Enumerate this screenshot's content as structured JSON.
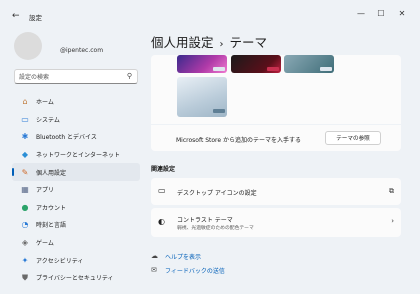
{
  "window": {
    "title": "設定",
    "back_glyph": "←",
    "minimize_glyph": "—",
    "maximize_glyph": "☐",
    "close_glyph": "✕"
  },
  "profile": {
    "email": "@ipentec.com"
  },
  "search": {
    "placeholder": "設定の検索"
  },
  "nav": {
    "items": [
      {
        "label": "ホーム",
        "icon": "home-icon",
        "glyph": "⌂",
        "color": "#c07a3a"
      },
      {
        "label": "システム",
        "icon": "system-icon",
        "glyph": "▭",
        "color": "#2b7bd6"
      },
      {
        "label": "Bluetooth とデバイス",
        "icon": "bluetooth-icon",
        "glyph": "✱",
        "color": "#2b7bd6"
      },
      {
        "label": "ネットワークとインターネット",
        "icon": "network-icon",
        "glyph": "◆",
        "color": "#2b8fd6"
      },
      {
        "label": "個人用設定",
        "icon": "personalization-icon",
        "glyph": "✎",
        "color": "#d06a2a"
      },
      {
        "label": "アプリ",
        "icon": "apps-icon",
        "glyph": "▦",
        "color": "#5a6a8a"
      },
      {
        "label": "アカウント",
        "icon": "accounts-icon",
        "glyph": "●",
        "color": "#2ba36a"
      },
      {
        "label": "時刻と言語",
        "icon": "time-language-icon",
        "glyph": "◔",
        "color": "#2b7bd6"
      },
      {
        "label": "ゲーム",
        "icon": "gaming-icon",
        "glyph": "◈",
        "color": "#6a6a6a"
      },
      {
        "label": "アクセシビリティ",
        "icon": "accessibility-icon",
        "glyph": "✦",
        "color": "#2b7bd6"
      },
      {
        "label": "プライバシーとセキュリティ",
        "icon": "privacy-icon",
        "glyph": "⛊",
        "color": "#6a6a6a"
      }
    ],
    "active_index": 4
  },
  "header": {
    "crumb": "個人用設定",
    "separator": "›",
    "page": "テーマ"
  },
  "themes": {
    "store_text": "Microsoft Store から追加のテーマを入手する",
    "browse_button": "テーマの参照"
  },
  "related": {
    "heading": "関連設定",
    "desktop_icons": {
      "title": "デスクトップ アイコンの設定",
      "end_glyph": "⧉"
    },
    "contrast": {
      "title": "コントラスト テーマ",
      "subtitle": "弱視、光過敏症のための配色テーマ",
      "end_glyph": "›"
    }
  },
  "links": {
    "help": {
      "label": "ヘルプを表示",
      "glyph": "☁"
    },
    "feedback": {
      "label": "フィードバックの送信",
      "glyph": "✉"
    }
  }
}
